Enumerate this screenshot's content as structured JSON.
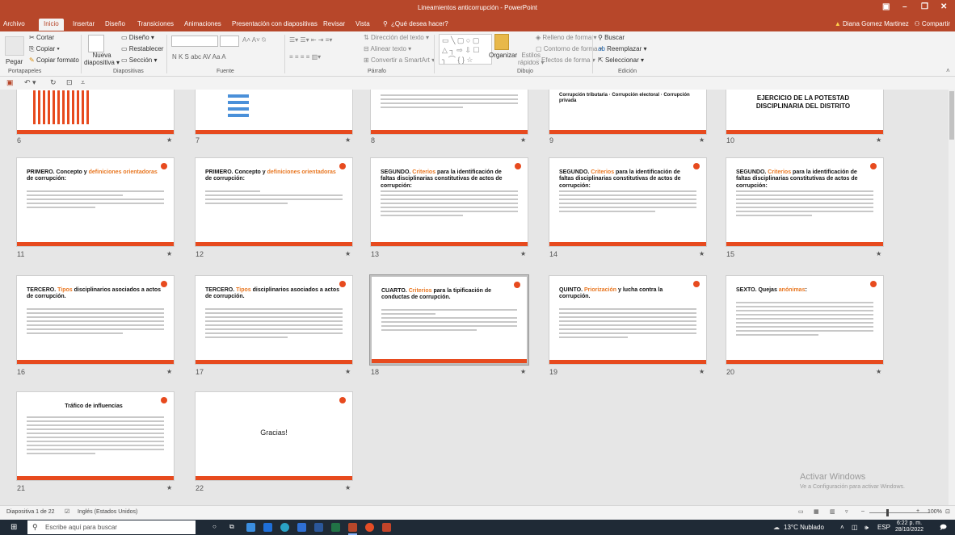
{
  "window": {
    "title": "Lineamientos anticorrupción - PowerPoint"
  },
  "tabs": [
    "Archivo",
    "Inicio",
    "Insertar",
    "Diseño",
    "Transiciones",
    "Animaciones",
    "Presentación con diapositivas",
    "Revisar",
    "Vista"
  ],
  "search": {
    "placeholder": "¿Qué desea hacer?"
  },
  "user": {
    "name": "Diana Gomez Martinez",
    "share": "Compartir"
  },
  "ribbon": {
    "clipboard": {
      "paste": "Pegar",
      "cut": "Cortar",
      "copy": "Copiar",
      "format": "Copiar formato",
      "label": "Portapapeles"
    },
    "slides": {
      "new": "Nueva",
      "new2": "diapositiva",
      "design": "Diseño",
      "reset": "Restablecer",
      "section": "Sección",
      "label": "Diapositivas"
    },
    "font": {
      "label": "Fuente",
      "chars": "N  K  S  abc  AV  Aa  A"
    },
    "paragraph": {
      "label": "Párrafo",
      "dir": "Dirección del texto",
      "align": "Alinear texto",
      "smartart": "Convertir a SmartArt"
    },
    "drawing": {
      "arrange": "Organizar",
      "styles": "Estilos",
      "styles2": "rápidos",
      "fill": "Relleno de forma",
      "outline": "Contorno de forma",
      "effects": "Efectos de forma",
      "label": "Dibujo"
    },
    "editing": {
      "find": "Buscar",
      "replace": "Reemplazar",
      "select": "Seleccionar",
      "label": "Edición"
    }
  },
  "slides": [
    {
      "n": "6",
      "title": ""
    },
    {
      "n": "7",
      "title": ""
    },
    {
      "n": "8",
      "title": ""
    },
    {
      "n": "9",
      "title": "Corrupción tributaria · Corrupción electoral · Corrupción privada"
    },
    {
      "n": "10",
      "title": "EJERCICIO DE LA POTESTAD DISCIPLINARIA DEL DISTRITO"
    },
    {
      "n": "11",
      "title": "PRIMERO. Concepto y definiciones orientadoras de corrupción:"
    },
    {
      "n": "12",
      "title": "PRIMERO. Concepto y definiciones orientadoras de corrupción:"
    },
    {
      "n": "13",
      "title": "SEGUNDO. Criterios para la identificación de faltas disciplinarias constitutivas de actos de corrupción:"
    },
    {
      "n": "14",
      "title": "SEGUNDO. Criterios para la identificación de faltas disciplinarias constitutivas de actos de corrupción:"
    },
    {
      "n": "15",
      "title": "SEGUNDO. Criterios para la identificación de faltas disciplinarias constitutivas de actos de corrupción:"
    },
    {
      "n": "16",
      "title": "TERCERO. Tipos disciplinarios asociados a actos de corrupción."
    },
    {
      "n": "17",
      "title": "TERCERO. Tipos disciplinarios asociados a actos de corrupción."
    },
    {
      "n": "18",
      "title": "CUARTO. Criterios para la tipificación de conductas de corrupción."
    },
    {
      "n": "19",
      "title": "QUINTO. Priorización y lucha contra la corrupción."
    },
    {
      "n": "20",
      "title": "SEXTO. Quejas anónimas:"
    },
    {
      "n": "21",
      "title": "Tráfico de influencias"
    },
    {
      "n": "22",
      "title": "Gracias!"
    }
  ],
  "activation": {
    "line1": "Activar Windows",
    "line2": "Ve a Configuración para activar Windows."
  },
  "status": {
    "slide": "Diapositiva 1 de 22",
    "lang": "Inglés (Estados Unidos)",
    "zoom": "100%"
  },
  "taskbar": {
    "search": "Escribe aquí para buscar",
    "weather": "13°C  Nublado",
    "lang": "ESP",
    "time": "6:22 p. m.",
    "date": "28/10/2022"
  }
}
